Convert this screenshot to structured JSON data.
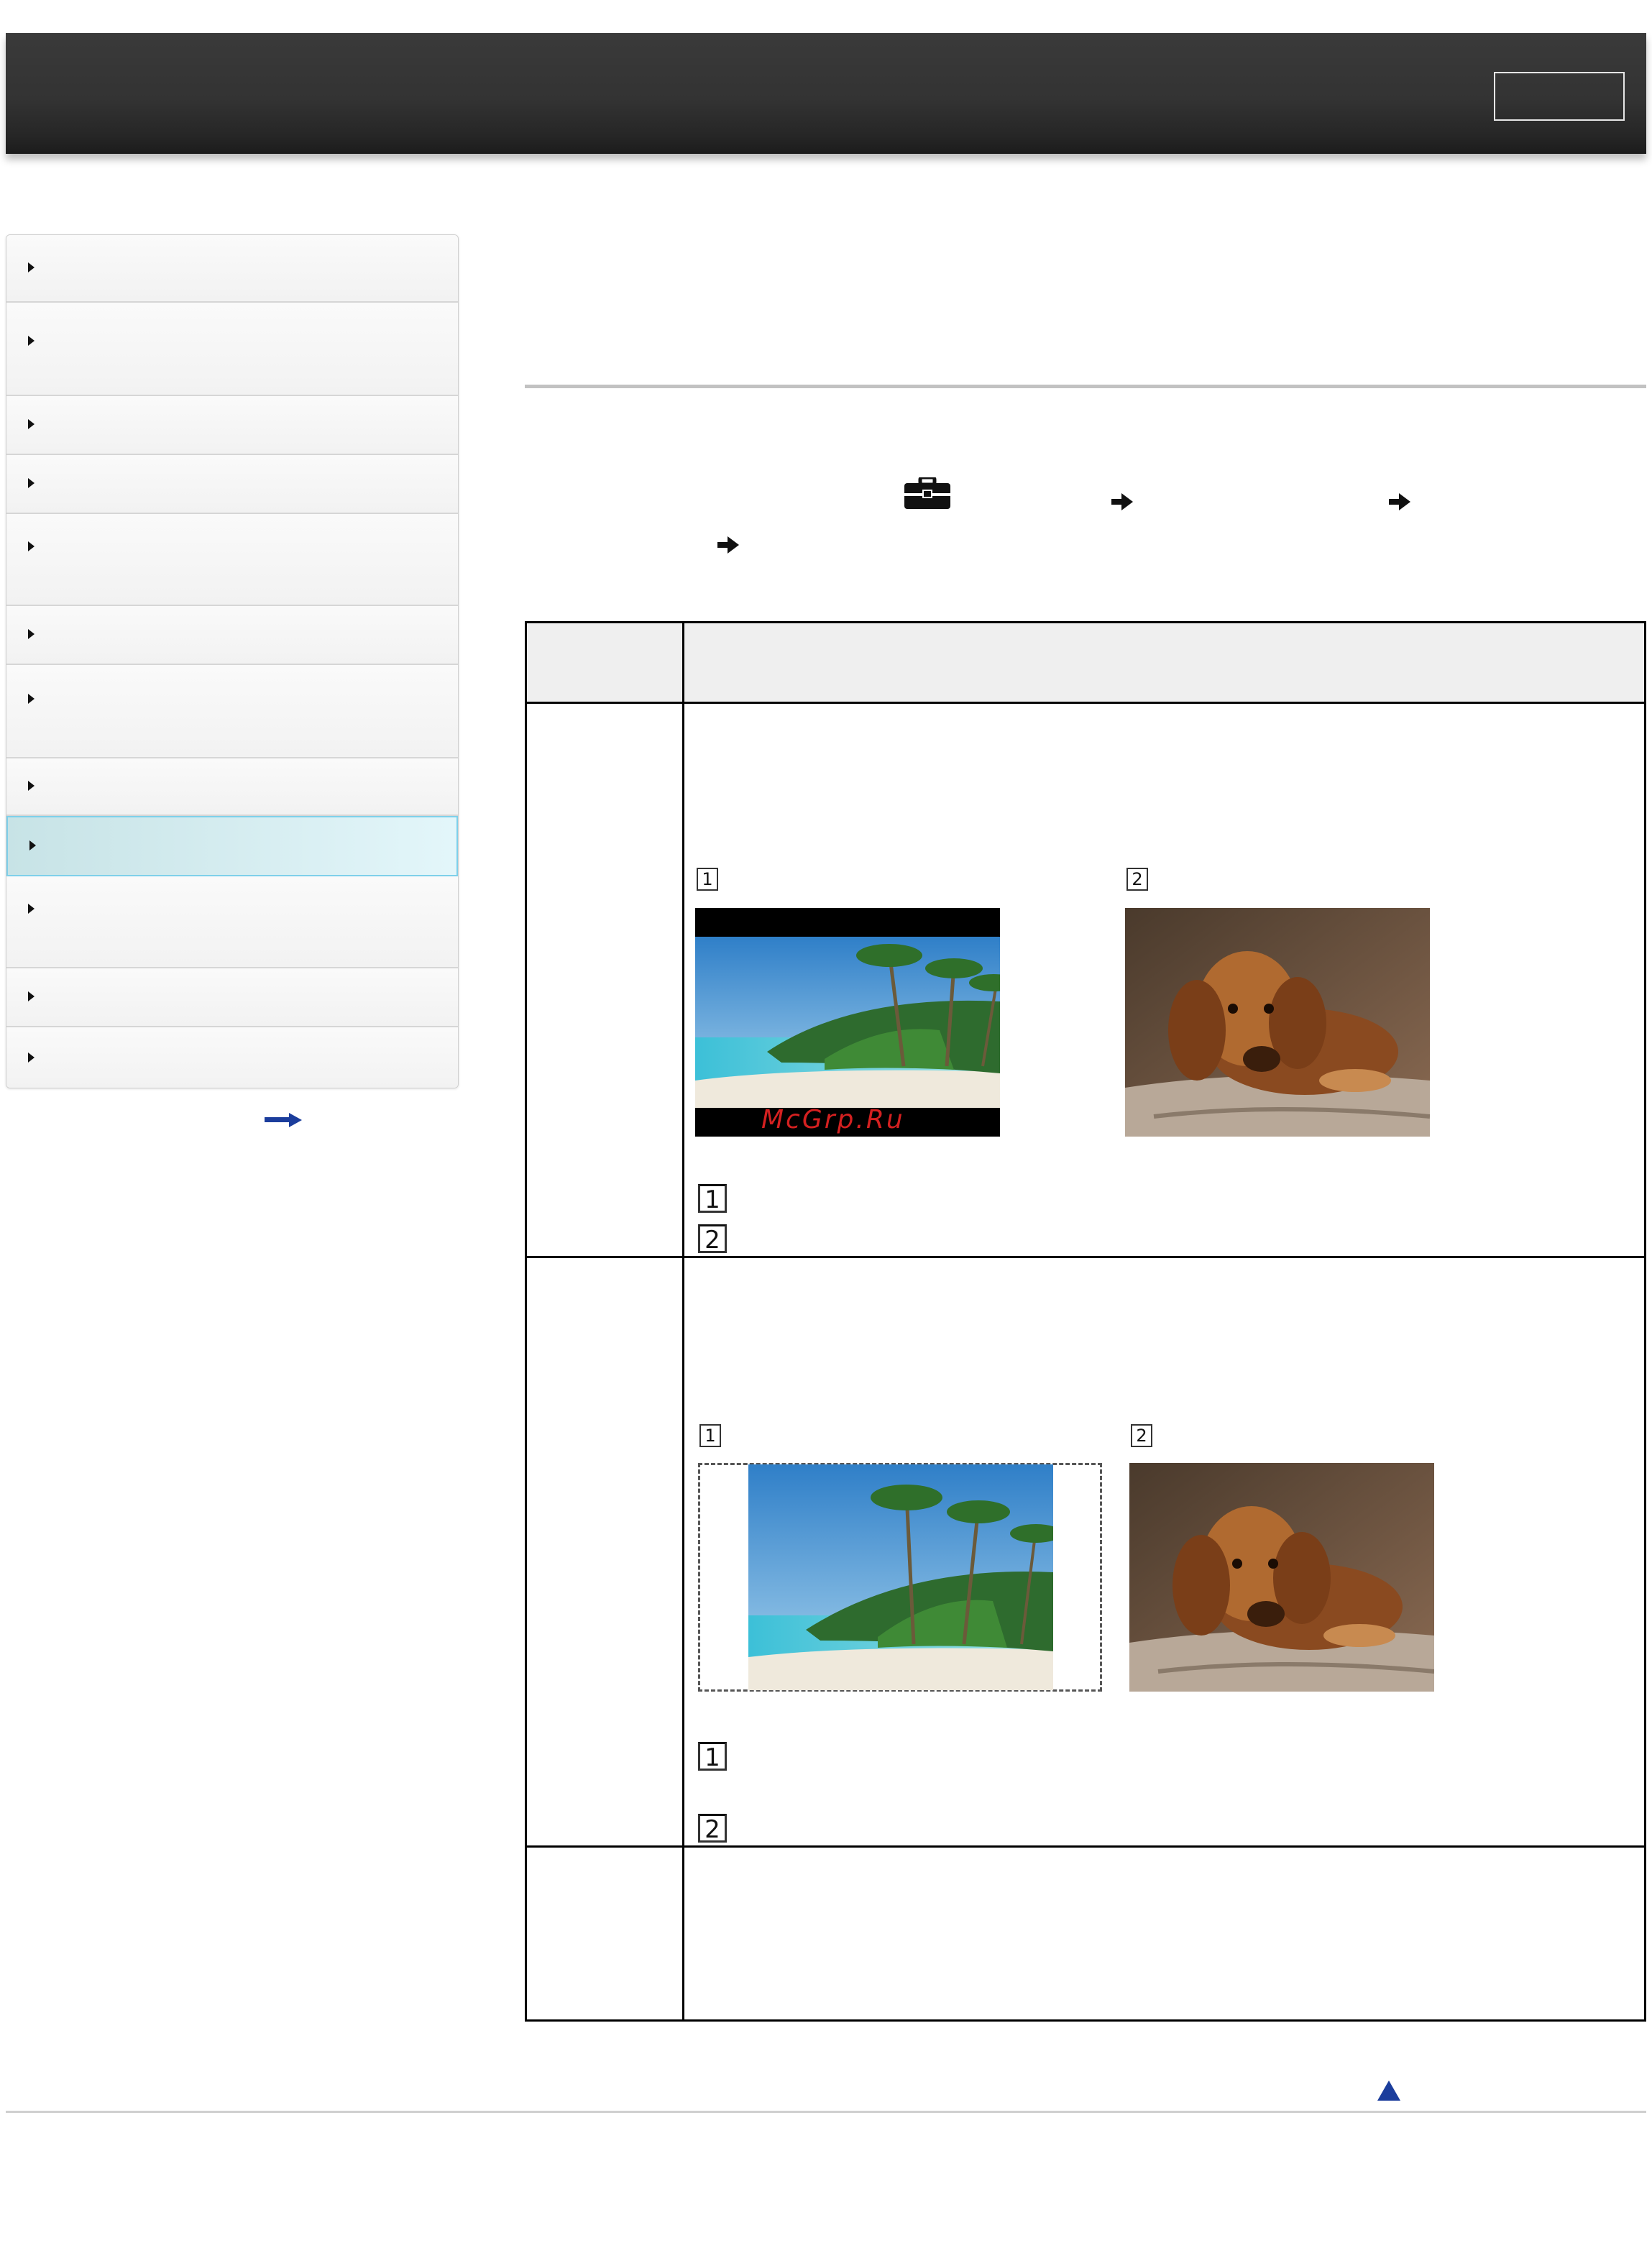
{
  "header": {
    "title": "",
    "button_label": ""
  },
  "sidebar": {
    "items": [
      {
        "label": ""
      },
      {
        "label": ""
      },
      {
        "label": ""
      },
      {
        "label": ""
      },
      {
        "label": ""
      },
      {
        "label": ""
      },
      {
        "label": ""
      },
      {
        "label": ""
      },
      {
        "label": "",
        "active": true
      },
      {
        "label": ""
      },
      {
        "label": ""
      },
      {
        "label": ""
      }
    ],
    "more_link_icon": "right-arrow-icon"
  },
  "content": {
    "title": "",
    "menu_path_icons": [
      "toolbox-icon",
      "arrow-right-icon",
      "arrow-right-icon",
      "arrow-right-icon"
    ],
    "table": {
      "rows": [
        {
          "badges": [
            "1",
            "2"
          ],
          "legend_badges": [
            "1",
            "2"
          ],
          "watermark": "McGrp.Ru"
        },
        {
          "badges": [
            "1",
            "2"
          ],
          "legend_badges": [
            "1",
            "2"
          ]
        }
      ]
    }
  },
  "footer": {
    "top_icon": "up-triangle-icon"
  },
  "colors": {
    "header": "#333333",
    "active_nav": "#e3f6fa",
    "active_nav_border": "#7ed0ea",
    "link_blue": "#1b3d9c",
    "watermark": "#d42020"
  }
}
